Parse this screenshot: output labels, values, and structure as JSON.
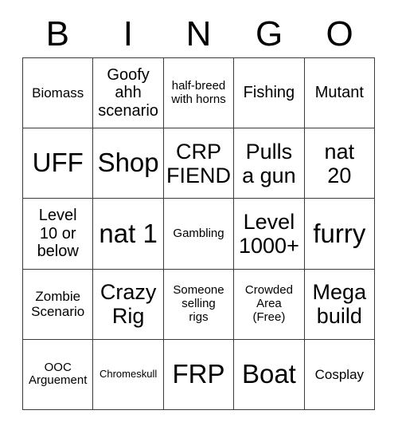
{
  "card": {
    "header_letters": [
      "B",
      "I",
      "N",
      "G",
      "O"
    ],
    "grid_border_color": "#3b3b3b",
    "background_color": "#ffffff",
    "text_color": "#000000",
    "rows": [
      [
        {
          "text": "Biomass",
          "size": "md"
        },
        {
          "text": "Goofy\nahh\nscenario",
          "size": "lg"
        },
        {
          "text": "half-breed\nwith horns",
          "size": "sm"
        },
        {
          "text": "Fishing",
          "size": "lg"
        },
        {
          "text": "Mutant",
          "size": "lg"
        }
      ],
      [
        {
          "text": "UFF",
          "size": "xxl"
        },
        {
          "text": "Shop",
          "size": "xxl"
        },
        {
          "text": "CRP\nFIEND",
          "size": "xl"
        },
        {
          "text": "Pulls\na gun",
          "size": "xl"
        },
        {
          "text": "nat\n20",
          "size": "xl"
        }
      ],
      [
        {
          "text": "Level\n10 or\nbelow",
          "size": "lg"
        },
        {
          "text": "nat 1",
          "size": "xxl"
        },
        {
          "text": "Gambling",
          "size": "sm"
        },
        {
          "text": "Level\n1000+",
          "size": "xl"
        },
        {
          "text": "furry",
          "size": "xxl"
        }
      ],
      [
        {
          "text": "Zombie\nScenario",
          "size": "md"
        },
        {
          "text": "Crazy\nRig",
          "size": "xl"
        },
        {
          "text": "Someone\nselling\nrigs",
          "size": "sm"
        },
        {
          "text": "Crowded\nArea\n(Free)",
          "size": "sm"
        },
        {
          "text": "Mega\nbuild",
          "size": "xl"
        }
      ],
      [
        {
          "text": "OOC\nArguement",
          "size": "sm"
        },
        {
          "text": "Chromeskull",
          "size": "xs"
        },
        {
          "text": "FRP",
          "size": "xxl"
        },
        {
          "text": "Boat",
          "size": "xxl"
        },
        {
          "text": "Cosplay",
          "size": "md"
        }
      ]
    ]
  }
}
